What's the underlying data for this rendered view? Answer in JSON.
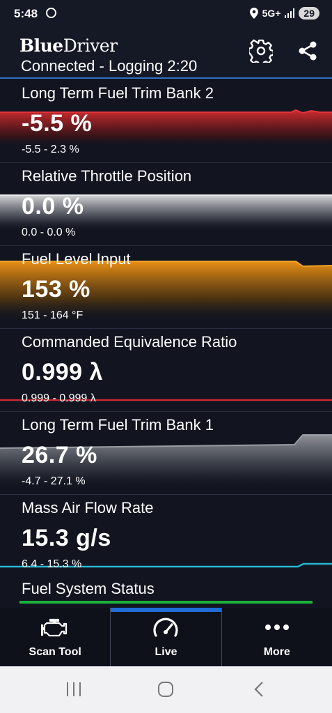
{
  "status_bar": {
    "time": "5:48",
    "network": "5G+",
    "battery": "29"
  },
  "header": {
    "brand_bold": "Blue",
    "brand_rest": "Driver",
    "connection": "Connected - Logging 2:20",
    "settings_icon": "gear-icon",
    "share_icon": "share-icon"
  },
  "colors": {
    "red": "#c8282d",
    "grey": "#c9cbce",
    "orange": "#e38a12",
    "cyan": "#27b4cf",
    "green": "#1bb13a",
    "accent_blue": "#1f6cd6"
  },
  "gauges": [
    {
      "label": "Long Term Fuel Trim Bank 2",
      "value": "-5.5 %",
      "range": "-5.5 - 2.3 %",
      "color": "red"
    },
    {
      "label": "Relative Throttle Position",
      "value": "0.0 %",
      "range": "0.0 - 0.0 %",
      "color": "grey"
    },
    {
      "label": "Fuel Level Input",
      "value": "153 %",
      "range": "151 - 164 °F",
      "color": "orange"
    },
    {
      "label": "Commanded Equivalence Ratio",
      "value": "0.999 λ",
      "range": "0.999 - 0.999 λ",
      "color": "red"
    },
    {
      "label": "Long Term Fuel Trim Bank 1",
      "value": "26.7 %",
      "range": "-4.7 - 27.1 %",
      "color": "grey"
    },
    {
      "label": "Mass Air Flow Rate",
      "value": "15.3 g/s",
      "range": "6.4 - 15.3 %",
      "color": "cyan"
    },
    {
      "label": "Fuel System Status",
      "color": "green"
    }
  ],
  "bottom_nav": [
    {
      "label": "Scan Tool",
      "icon": "engine-icon",
      "active": false
    },
    {
      "label": "Live",
      "icon": "speedometer-icon",
      "active": true
    },
    {
      "label": "More",
      "icon": "more-dots-icon",
      "active": false
    }
  ],
  "system_nav": {
    "recent_icon": "recent-apps-icon",
    "home_icon": "home-icon",
    "back_icon": "back-icon"
  }
}
